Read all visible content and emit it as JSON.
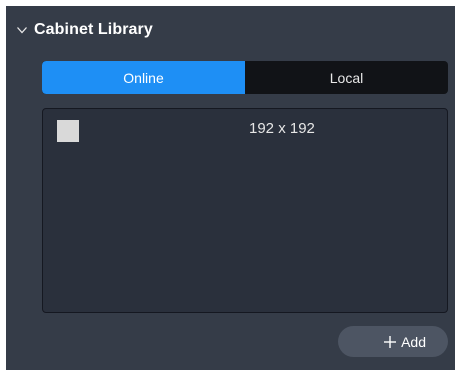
{
  "panel": {
    "title": "Cabinet Library"
  },
  "tabs": [
    {
      "label": "Online",
      "active": true
    },
    {
      "label": "Local",
      "active": false
    }
  ],
  "cabinets": [
    {
      "name": "192 x 192"
    }
  ],
  "add_button": {
    "label": "Add"
  },
  "colors": {
    "panel_bg": "#353c48",
    "active_tab": "#1e8ff5",
    "inactive_tab": "#111317",
    "list_bg": "#2a303c",
    "button_bg": "#4d5563"
  },
  "icons": {
    "collapse": "chevron-down-icon",
    "add": "plus-icon"
  }
}
